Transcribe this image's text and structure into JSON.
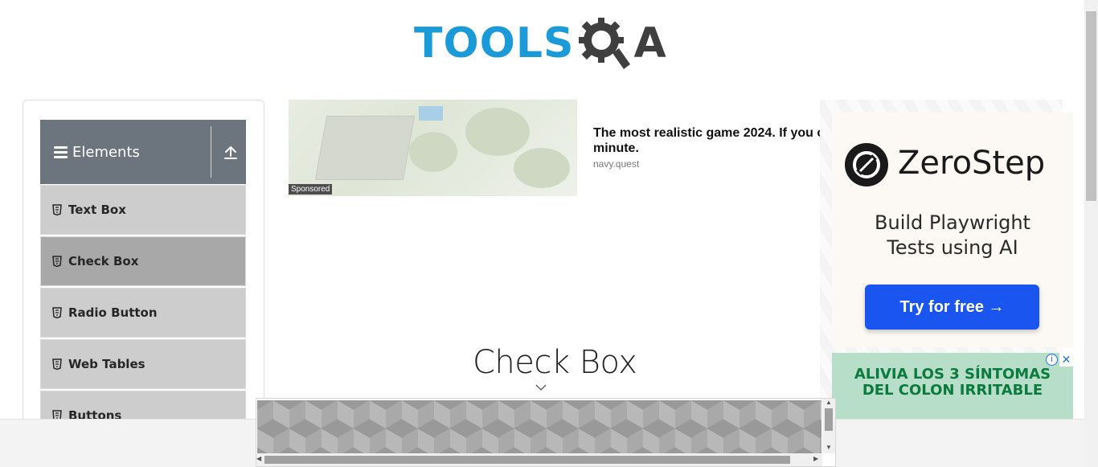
{
  "header": {
    "logo_text": "TOOLS",
    "logo_suffix": "A"
  },
  "sidebar": {
    "group_title": "Elements",
    "items": [
      {
        "label": "Text Box",
        "active": false
      },
      {
        "label": "Check Box",
        "active": true
      },
      {
        "label": "Radio Button",
        "active": false
      },
      {
        "label": "Web Tables",
        "active": false
      },
      {
        "label": "Buttons",
        "active": false
      }
    ]
  },
  "sponsored_ad": {
    "badge": "Sponsored",
    "title_line1": "The most realistic game 2024. If you c",
    "title_line2": "minute.",
    "source": "navy.quest"
  },
  "main": {
    "page_title": "Check Box"
  },
  "right_ad": {
    "brand": "ZeroStep",
    "tagline_line1": "Build Playwright",
    "tagline_line2": "Tests using AI",
    "cta": "Try for free →"
  },
  "second_ad": {
    "line1": "ALIVIA LOS 3  SÍNTOMAS",
    "line2": "DEL COLON IRRITABLE",
    "close": "✕",
    "info": "i"
  },
  "colors": {
    "brand_blue": "#1b9ad8",
    "sidebar_header": "#6c757d",
    "menu_item": "#cdcdcd",
    "menu_active": "#a8a8a8",
    "cta_blue": "#1a55f0"
  }
}
